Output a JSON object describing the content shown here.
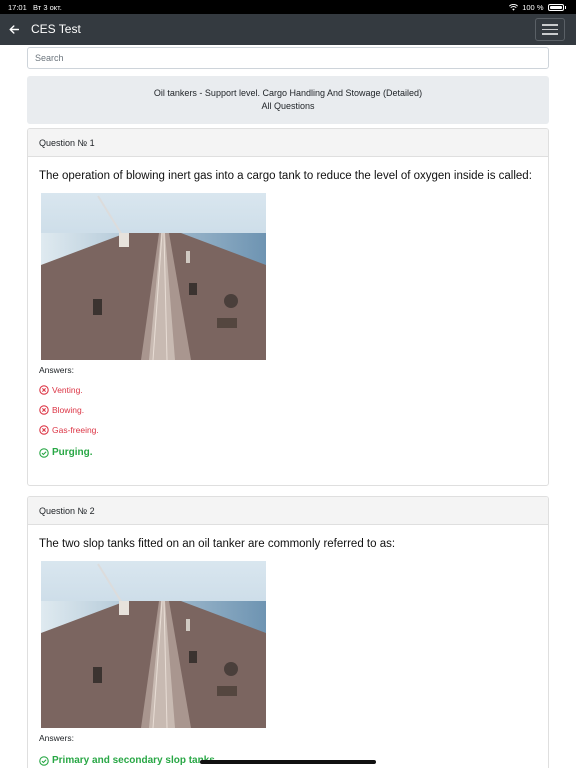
{
  "status_bar": {
    "time": "17:01",
    "date": "Вт 3 окт.",
    "battery": "100 %"
  },
  "navbar": {
    "title": "CES Test",
    "back_icon": "arrow-left-icon",
    "menu_icon": "hamburger-menu-icon"
  },
  "search": {
    "placeholder": "Search",
    "value": ""
  },
  "header": {
    "title": "Oil tankers - Support level. Cargo Handling And Stowage (Detailed)",
    "subtitle": "All Questions"
  },
  "questions": [
    {
      "number_label": "Question № 1",
      "text": "The operation of blowing inert gas into a cargo tank to reduce the level of oxygen inside is called:",
      "answers_label": "Answers:",
      "answers": [
        {
          "text": "Venting.",
          "correct": false
        },
        {
          "text": "Blowing.",
          "correct": false
        },
        {
          "text": "Gas-freeing.",
          "correct": false
        },
        {
          "text": "Purging.",
          "correct": true
        }
      ]
    },
    {
      "number_label": "Question № 2",
      "text": "The two slop tanks fitted on an oil tanker are commonly referred to as:",
      "answers_label": "Answers:",
      "answers": [
        {
          "text": "Primary and secondary slop tanks",
          "correct": true
        }
      ]
    }
  ],
  "colors": {
    "navbar": "#343a40",
    "wrong": "#dc3545",
    "correct": "#28a745",
    "header_bg": "#e9ecef"
  }
}
